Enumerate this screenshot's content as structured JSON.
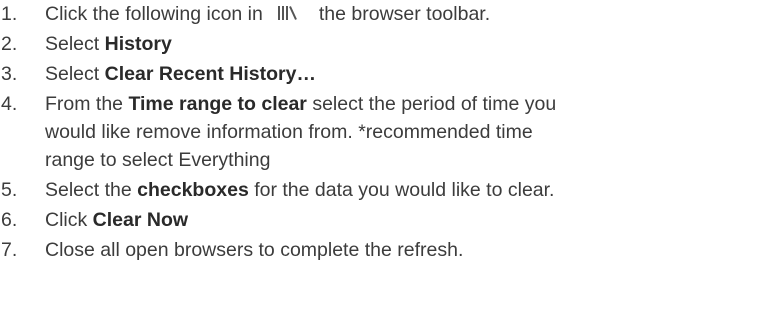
{
  "steps": [
    {
      "number": "1.",
      "text_before": "Click the following icon in",
      "icon": "library-icon",
      "text_after": "the browser toolbar."
    },
    {
      "number": "2.",
      "text_before": "Select ",
      "bold": "History"
    },
    {
      "number": "3.",
      "text_before": "Select ",
      "bold": "Clear Recent History…"
    },
    {
      "number": "4.",
      "text_before": "From the ",
      "bold": "Time range to clear",
      "text_after": " select the period of time you would like remove information from. *recommended time range to select Everything",
      "line1": " select the period of time you",
      "line2": "would like remove information from. *recommended time",
      "line3": "range to select Everything"
    },
    {
      "number": "5.",
      "text_before": "Select the ",
      "bold": "checkboxes",
      "text_after": " for the data you would like to clear."
    },
    {
      "number": "6.",
      "text_before": "Click ",
      "bold": "Clear Now"
    },
    {
      "number": "7.",
      "text_before": "Close all open browsers to complete the refresh."
    }
  ],
  "colors": {
    "text": "#3c3c3c",
    "icon": "#555555"
  }
}
